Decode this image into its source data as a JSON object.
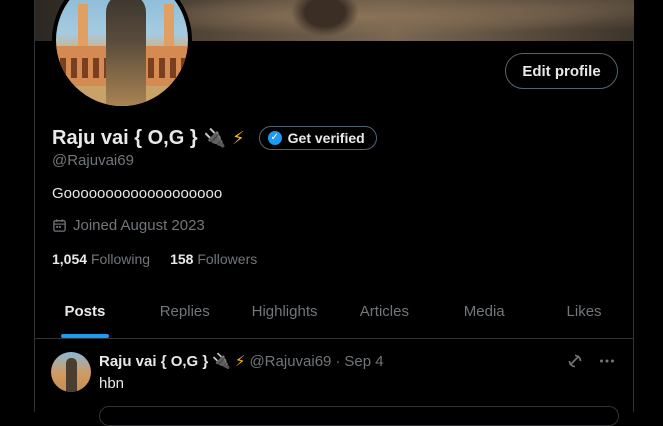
{
  "profile": {
    "display_name": "Raju vai { O,G }",
    "emoji_plug": "🔌",
    "emoji_bolt": "⚡",
    "verify_label": "Get verified",
    "handle": "@Rajuvai69",
    "bio": "Gooooooooooooooooooo",
    "joined": "Joined August 2023",
    "following_count": "1,054",
    "following_label": "Following",
    "followers_count": "158",
    "followers_label": "Followers",
    "edit_button": "Edit profile"
  },
  "tabs": [
    {
      "label": "Posts",
      "active": true
    },
    {
      "label": "Replies"
    },
    {
      "label": "Highlights"
    },
    {
      "label": "Articles"
    },
    {
      "label": "Media"
    },
    {
      "label": "Likes"
    }
  ],
  "post": {
    "name": "Raju vai { O,G }",
    "emoji_plug": "🔌",
    "emoji_bolt": "⚡",
    "handle": "@Rajuvai69",
    "separator": "·",
    "date": "Sep 4",
    "text": "hbn"
  },
  "colors": {
    "accent": "#1d9bf0",
    "muted": "#71767b",
    "text": "#e7e9ea",
    "border": "#2f3336"
  },
  "icons": {
    "verify": "verified-badge-icon",
    "calendar": "calendar-icon",
    "grok": "grok-icon",
    "more": "more-icon"
  }
}
